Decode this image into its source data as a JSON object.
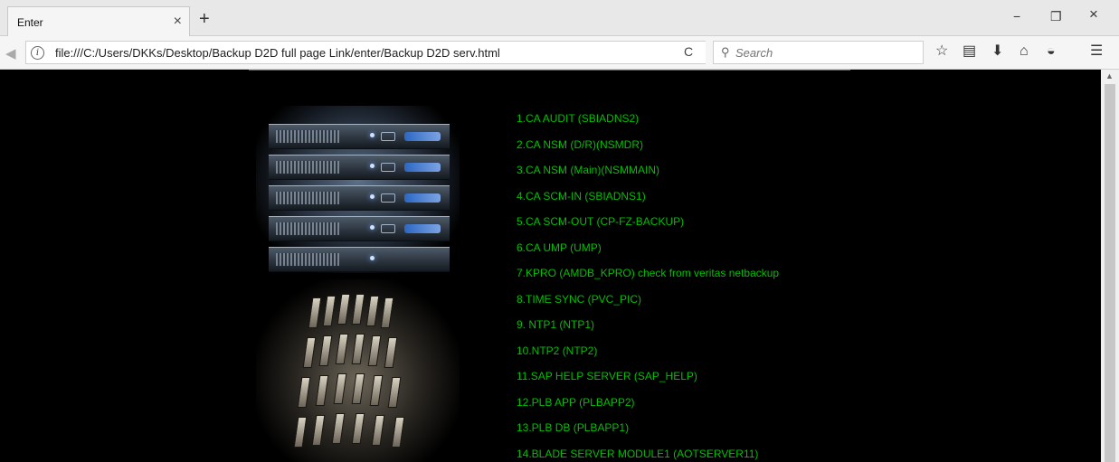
{
  "browser": {
    "tab": {
      "title": "Enter",
      "close_glyph": "×"
    },
    "new_tab_glyph": "+",
    "window_controls": {
      "minimize": "−",
      "restore": "❐",
      "close": "×"
    },
    "nav": {
      "back_icon": "back-arrow-icon",
      "info_icon": "info-icon",
      "info_glyph": "i",
      "url": "file:///C:/Users/DKKs/Desktop/Backup D2D full page Link/enter/Backup D2D serv.html",
      "reload_glyph": "C",
      "search_placeholder": "Search"
    },
    "toolbar_icons": [
      "star-icon",
      "reading-list-icon",
      "download-icon",
      "home-icon",
      "pocket-icon",
      "menu-icon"
    ]
  },
  "colors": {
    "page_background": "#000000",
    "link_color": "#00c000"
  },
  "page": {
    "server_links": [
      "1.CA AUDIT (SBIADNS2)",
      "2.CA NSM (D/R)(NSMDR)",
      "3.CA NSM (Main)(NSMMAIN)",
      "4.CA SCM-IN (SBIADNS1)",
      "5.CA SCM-OUT (CP-FZ-BACKUP)",
      "6.CA UMP (UMP)",
      "7.KPRO (AMDB_KPRO) check from veritas netbackup",
      "8.TIME SYNC (PVC_PIC)",
      "9. NTP1 (NTP1)",
      "10.NTP2 (NTP2)",
      "11.SAP HELP SERVER (SAP_HELP)",
      "12.PLB APP (PLBAPP2)",
      "13.PLB DB (PLBAPP1)",
      "14.BLADE SERVER MODULE1 (AOTSERVER11)"
    ]
  }
}
